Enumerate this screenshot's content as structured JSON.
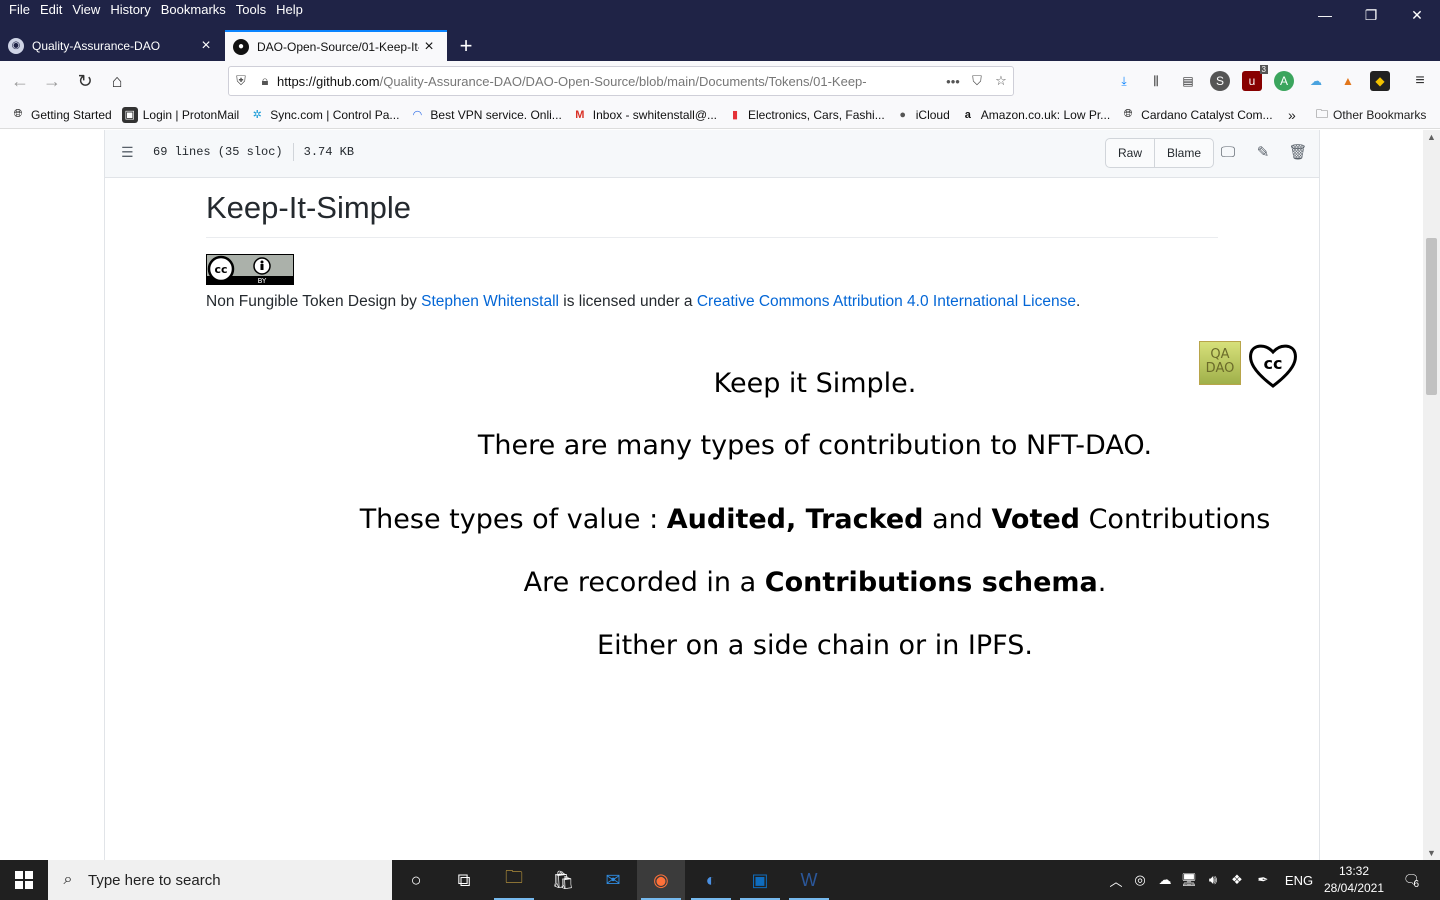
{
  "menubar": {
    "menus": [
      "File",
      "Edit",
      "View",
      "History",
      "Bookmarks",
      "Tools",
      "Help"
    ],
    "minimize": "—",
    "maximize": "❐",
    "close": "✕"
  },
  "tabs": [
    {
      "title": "Quality-Assurance-DAO",
      "icon": "qa-dao-favicon"
    },
    {
      "title": "DAO-Open-Source/01-Keep-It-",
      "icon": "github-favicon"
    }
  ],
  "nav": {
    "url_host": "https://github.com",
    "url_path": "/Quality-Assurance-DAO/DAO-Open-Source/blob/main/Documents/Tokens/01-Keep-",
    "extension_badge": "3"
  },
  "bookmarks": [
    {
      "label": "Getting Started",
      "icon": "globe-icon"
    },
    {
      "label": "Login | ProtonMail",
      "icon": "protonmail-icon"
    },
    {
      "label": "Sync.com | Control Pa...",
      "icon": "sync-icon"
    },
    {
      "label": "Best VPN service. Onli...",
      "icon": "vpn-icon"
    },
    {
      "label": "Inbox - swhitenstall@...",
      "icon": "gmail-icon"
    },
    {
      "label": "Electronics, Cars, Fashi...",
      "icon": "ebay-icon"
    },
    {
      "label": "iCloud",
      "icon": "apple-icon"
    },
    {
      "label": "Amazon.co.uk: Low Pr...",
      "icon": "amazon-icon"
    },
    {
      "label": "Cardano Catalyst Com...",
      "icon": "globe-icon"
    }
  ],
  "bookmarks_other": "Other Bookmarks",
  "file_header": {
    "lines": "69 lines (35 sloc)",
    "size": "3.74 KB",
    "raw": "Raw",
    "blame": "Blame"
  },
  "article": {
    "title": "Keep-It-Simple",
    "license_prefix": "Non Fungible Token Design by ",
    "author": "Stephen Whitenstall",
    "license_middle": " is licensed under a ",
    "license_name": "Creative Commons Attribution 4.0 International License",
    "license_suffix": ".",
    "badge_text": "BY",
    "qa_logo_line1": "QA",
    "qa_logo_line2": "DAO"
  },
  "slide": {
    "line1": "Keep it Simple.",
    "line2": "There are many types of contribution to NFT-DAO.",
    "line3_pre": "These types of value : ",
    "line3_bold1": "Audited, Tracked",
    "line3_mid": " and ",
    "line3_bold2": "Voted",
    "line3_post": " Contributions",
    "line4_pre": "Are recorded in a ",
    "line4_bold": "Contributions schema",
    "line4_post": ".",
    "line5": "Either on a side chain or in IPFS."
  },
  "taskbar": {
    "search_placeholder": "Type here to search",
    "lang": "ENG",
    "time": "13:32",
    "date": "28/04/2021",
    "notifications": "6"
  }
}
